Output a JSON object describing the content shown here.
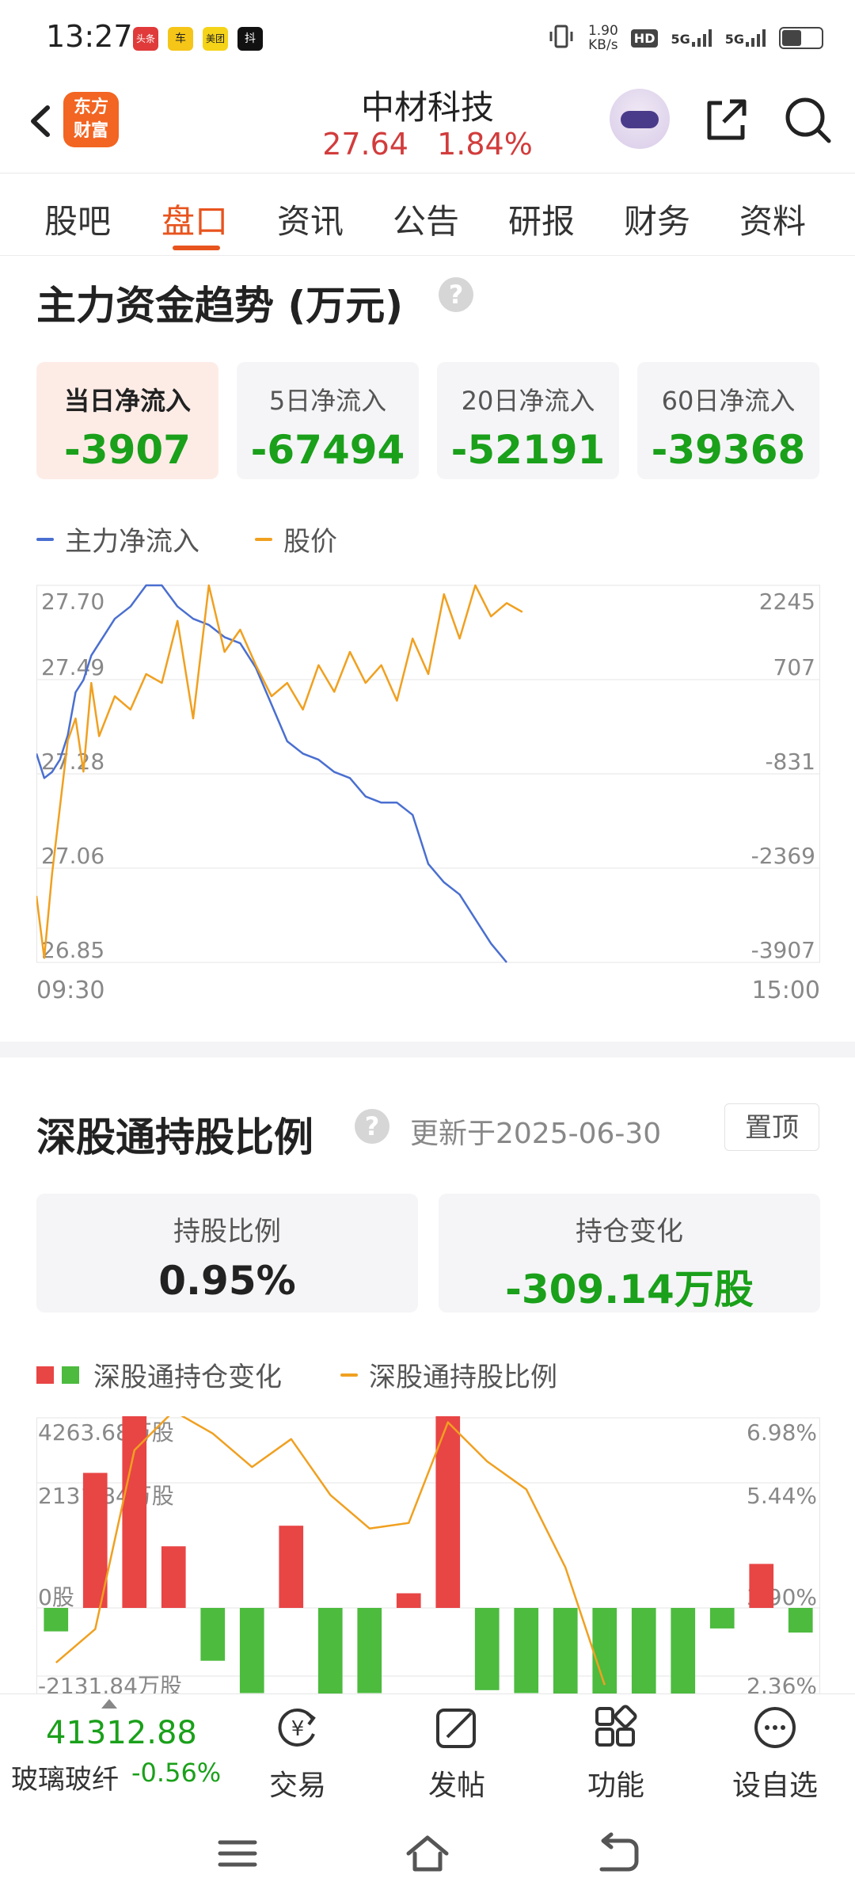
{
  "status_bar": {
    "time": "13:27",
    "app_icons": [
      "头条",
      "车",
      "美团",
      "抖"
    ],
    "net_speed_value": "1.90",
    "net_speed_unit": "KB/s",
    "hd_label": "HD",
    "signal1": "5G",
    "signal2": "5G"
  },
  "header": {
    "back_icon": "chevron-left-icon",
    "logo_text_top": "东方",
    "logo_text_bottom": "财富",
    "stock_name": "中材科技",
    "price": "27.64",
    "change_pct": "1.84%",
    "share_icon": "share-icon",
    "search_icon": "search-icon"
  },
  "tabs": [
    "股吧",
    "盘口",
    "资讯",
    "公告",
    "研报",
    "财务",
    "资料"
  ],
  "active_tab": 1,
  "capital_flow": {
    "title": "主力资金趋势 (万元)",
    "cards": [
      {
        "label": "当日净流入",
        "value": "-3907"
      },
      {
        "label": "5日净流入",
        "value": "-67494"
      },
      {
        "label": "20日净流入",
        "value": "-52191"
      },
      {
        "label": "60日净流入",
        "value": "-39368"
      }
    ],
    "legend_flow": "主力净流入",
    "legend_price": "股价"
  },
  "chart_data": [
    {
      "type": "line",
      "title": "",
      "x_start": "09:30",
      "x_end": "15:00",
      "left_axis_ticks": [
        "27.70",
        "27.49",
        "27.28",
        "27.06",
        "26.85"
      ],
      "right_axis_ticks": [
        "2245",
        "707",
        "-831",
        "-2369",
        "-3907"
      ],
      "left_ylim": [
        26.85,
        27.7
      ],
      "right_ylim": [
        -3907,
        2245
      ],
      "grid": true,
      "series": [
        {
          "name": "主力净流入",
          "color": "#4a6fd0",
          "axis": "right",
          "x_fraction_of_session": [
            0.0,
            0.01,
            0.02,
            0.03,
            0.04,
            0.05,
            0.06,
            0.07,
            0.08,
            0.1,
            0.12,
            0.14,
            0.16,
            0.18,
            0.2,
            0.22,
            0.24,
            0.26,
            0.28,
            0.3,
            0.32,
            0.34,
            0.36,
            0.38,
            0.4,
            0.42,
            0.44,
            0.46,
            0.48,
            0.5,
            0.52,
            0.54,
            0.56,
            0.58,
            0.6
          ],
          "values": [
            -500,
            -900,
            -800,
            -600,
            -200,
            500,
            700,
            1100,
            1300,
            1700,
            1900,
            2245,
            2245,
            1900,
            1700,
            1600,
            1400,
            1300,
            900,
            300,
            -300,
            -500,
            -600,
            -800,
            -900,
            -1200,
            -1300,
            -1300,
            -1500,
            -2300,
            -2600,
            -2800,
            -3200,
            -3600,
            -3907
          ]
        },
        {
          "name": "股价",
          "color": "#f0a020",
          "axis": "left",
          "x_fraction_of_session": [
            0.0,
            0.01,
            0.02,
            0.03,
            0.04,
            0.05,
            0.06,
            0.07,
            0.08,
            0.1,
            0.12,
            0.14,
            0.16,
            0.18,
            0.2,
            0.22,
            0.24,
            0.26,
            0.28,
            0.3,
            0.32,
            0.34,
            0.36,
            0.38,
            0.4,
            0.42,
            0.44,
            0.46,
            0.48,
            0.5,
            0.52,
            0.54,
            0.56,
            0.58,
            0.6,
            0.62
          ],
          "values": [
            27.0,
            26.86,
            27.05,
            27.2,
            27.35,
            27.4,
            27.28,
            27.48,
            27.36,
            27.45,
            27.42,
            27.5,
            27.48,
            27.62,
            27.4,
            27.7,
            27.55,
            27.6,
            27.52,
            27.45,
            27.48,
            27.42,
            27.52,
            27.46,
            27.55,
            27.48,
            27.52,
            27.44,
            27.58,
            27.5,
            27.68,
            27.58,
            27.7,
            27.63,
            27.66,
            27.64
          ]
        }
      ]
    },
    {
      "type": "bar",
      "title": "",
      "left_axis_ticks": [
        "4263.68万股",
        "2131.84万股",
        "0股",
        "-2131.84万股"
      ],
      "right_axis_ticks": [
        "6.98%",
        "5.44%",
        "3.90%",
        "2.36%"
      ],
      "left_ylim": [
        -2131.84,
        4263.68
      ],
      "right_ylim": [
        2.36,
        6.98
      ],
      "grid": true,
      "series": [
        {
          "name": "深股通持仓变化",
          "unit": "万股",
          "values": [
            -400,
            2300,
            4263.68,
            1050,
            -900,
            -1450,
            1400,
            -2250,
            -1450,
            250,
            3550,
            -1400,
            -1450,
            -2700,
            -2900,
            -1700,
            -1600,
            -350,
            750,
            -420
          ]
        },
        {
          "name": "深股通持股比例",
          "unit": "%",
          "values": [
            2.6,
            3.2,
            6.4,
            7.1,
            6.7,
            6.1,
            6.6,
            5.6,
            5.0,
            5.1,
            6.9,
            6.2,
            5.7,
            4.3,
            2.2
          ]
        }
      ]
    }
  ],
  "sgt": {
    "title": "深股通持股比例",
    "updated": "更新于2025-06-30",
    "pin_label": "置顶",
    "ratio_label": "持股比例",
    "ratio_value": "0.95%",
    "change_label": "持仓变化",
    "change_value": "-309.14万股",
    "legend_change": "深股通持仓变化",
    "legend_ratio": "深股通持股比例"
  },
  "bottom_bar": {
    "index_value": "41312.88",
    "index_name": "玻璃玻纤",
    "index_change": "-0.56%",
    "trade_label": "交易",
    "post_label": "发帖",
    "func_label": "功能",
    "watch_label": "设自选"
  },
  "colors": {
    "accent": "#e8541e",
    "up": "#d23c3c",
    "down": "#1aa01a",
    "flow_line": "#4a6fd0",
    "price_line": "#f0a020",
    "bar_up": "#e84545",
    "bar_down": "#4cbb3e"
  }
}
